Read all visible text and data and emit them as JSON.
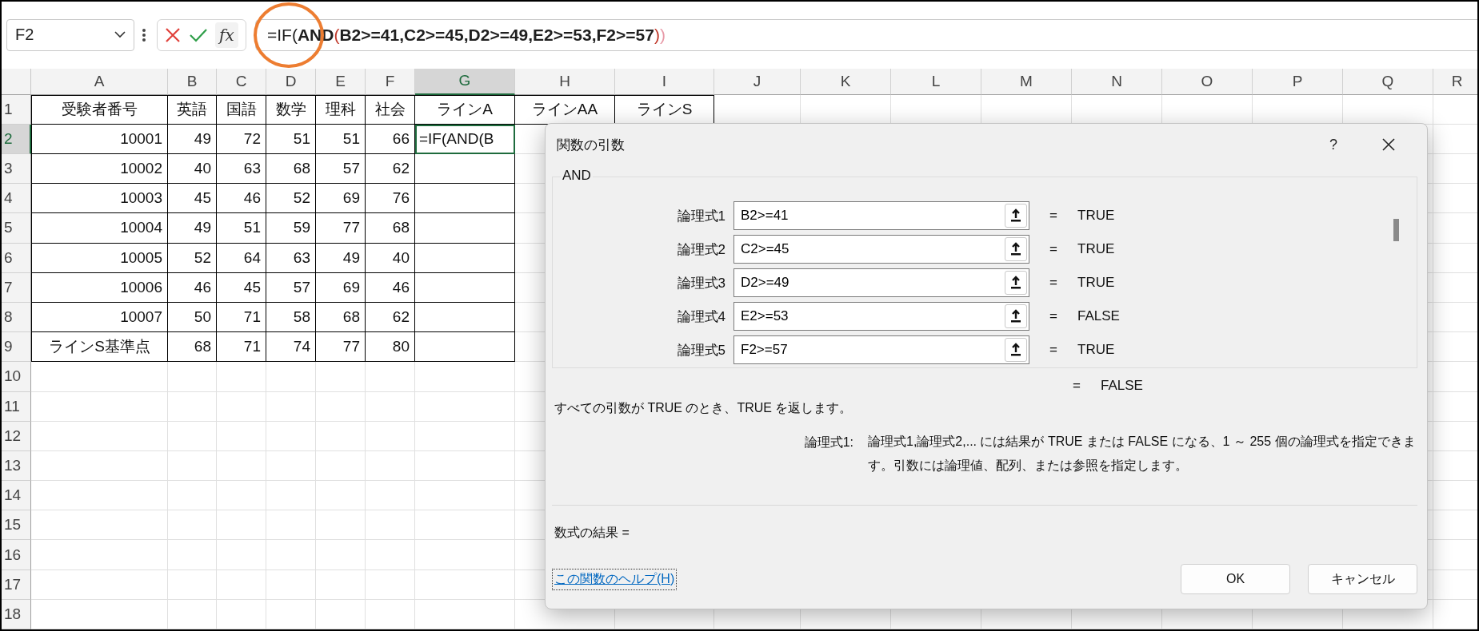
{
  "name_box": {
    "value": "F2"
  },
  "formula_bar": {
    "fx": "fx",
    "segments": [
      {
        "text": "=IF(",
        "bold": false,
        "color": "#1f1f1f"
      },
      {
        "text": "AND",
        "bold": true,
        "color": "#1f1f1f"
      },
      {
        "text": "(",
        "bold": false,
        "color": "#c0392b"
      },
      {
        "text": "B2>=41,C2>=45,D2>=49,E2>=53,F2>=57",
        "bold": true,
        "color": "#1f1f1f"
      },
      {
        "text": ")",
        "bold": false,
        "color": "#c0392b"
      },
      {
        "text": ")",
        "bold": false,
        "color": "#e89aa8"
      }
    ]
  },
  "sheet": {
    "columns": [
      {
        "label": "A",
        "selected": false
      },
      {
        "label": "B",
        "selected": false
      },
      {
        "label": "C",
        "selected": false
      },
      {
        "label": "D",
        "selected": false
      },
      {
        "label": "E",
        "selected": false
      },
      {
        "label": "F",
        "selected": false
      },
      {
        "label": "G",
        "selected": true
      },
      {
        "label": "H",
        "selected": false
      },
      {
        "label": "I",
        "selected": false
      },
      {
        "label": "J",
        "selected": false
      },
      {
        "label": "K",
        "selected": false
      },
      {
        "label": "L",
        "selected": false
      },
      {
        "label": "M",
        "selected": false
      },
      {
        "label": "N",
        "selected": false
      },
      {
        "label": "O",
        "selected": false
      },
      {
        "label": "P",
        "selected": false
      },
      {
        "label": "Q",
        "selected": false
      },
      {
        "label": "R",
        "selected": false
      }
    ],
    "rows": [
      {
        "label": "1",
        "selected": false,
        "kind": "header",
        "cells": [
          "受験者番号",
          "英語",
          "国語",
          "数学",
          "理科",
          "社会",
          "ラインA",
          "ラインAA",
          "ラインS"
        ]
      },
      {
        "label": "2",
        "selected": true,
        "kind": "data",
        "cells": [
          "10001",
          "49",
          "72",
          "51",
          "51",
          "66"
        ],
        "active_cell": "=IF(AND(B"
      },
      {
        "label": "3",
        "selected": false,
        "kind": "data",
        "cells": [
          "10002",
          "40",
          "63",
          "68",
          "57",
          "62"
        ]
      },
      {
        "label": "4",
        "selected": false,
        "kind": "data",
        "cells": [
          "10003",
          "45",
          "46",
          "52",
          "69",
          "76"
        ]
      },
      {
        "label": "5",
        "selected": false,
        "kind": "data",
        "cells": [
          "10004",
          "49",
          "51",
          "59",
          "77",
          "68"
        ]
      },
      {
        "label": "6",
        "selected": false,
        "kind": "data",
        "cells": [
          "10005",
          "52",
          "64",
          "63",
          "49",
          "40"
        ]
      },
      {
        "label": "7",
        "selected": false,
        "kind": "data",
        "cells": [
          "10006",
          "46",
          "45",
          "57",
          "69",
          "46"
        ]
      },
      {
        "label": "8",
        "selected": false,
        "kind": "data",
        "cells": [
          "10007",
          "50",
          "71",
          "58",
          "68",
          "62"
        ]
      },
      {
        "label": "9",
        "selected": false,
        "kind": "criteria",
        "cells": [
          "ラインS基準点",
          "68",
          "71",
          "74",
          "77",
          "80"
        ]
      },
      {
        "label": "10",
        "selected": false
      },
      {
        "label": "11",
        "selected": false
      },
      {
        "label": "12",
        "selected": false
      },
      {
        "label": "13",
        "selected": false
      },
      {
        "label": "14",
        "selected": false
      },
      {
        "label": "15",
        "selected": false
      },
      {
        "label": "16",
        "selected": false
      },
      {
        "label": "17",
        "selected": false
      },
      {
        "label": "18",
        "selected": false
      }
    ]
  },
  "dialog": {
    "title": "関数の引数",
    "help_glyph": "?",
    "function_name": "AND",
    "arguments": [
      {
        "label": "論理式1",
        "value": "B2>=41",
        "equals": "=",
        "result": "TRUE"
      },
      {
        "label": "論理式2",
        "value": "C2>=45",
        "equals": "=",
        "result": "TRUE"
      },
      {
        "label": "論理式3",
        "value": "D2>=49",
        "equals": "=",
        "result": "TRUE"
      },
      {
        "label": "論理式4",
        "value": "E2>=53",
        "equals": "=",
        "result": "FALSE"
      },
      {
        "label": "論理式5",
        "value": "F2>=57",
        "equals": "=",
        "result": "TRUE"
      }
    ],
    "total_equals": "=",
    "total_result": "FALSE",
    "description": "すべての引数が TRUE のとき、TRUE を返します。",
    "argument_help_label": "論理式1:",
    "argument_help": "論理式1,論理式2,... には結果が TRUE または FALSE になる、1 ～ 255 個の論理式を指定できます。引数には論理値、配列、または参照を指定します。",
    "formula_result": "数式の結果 =",
    "help_link": "この関数のヘルプ(H)",
    "buttons": [
      "OK",
      "キャンセル"
    ]
  }
}
